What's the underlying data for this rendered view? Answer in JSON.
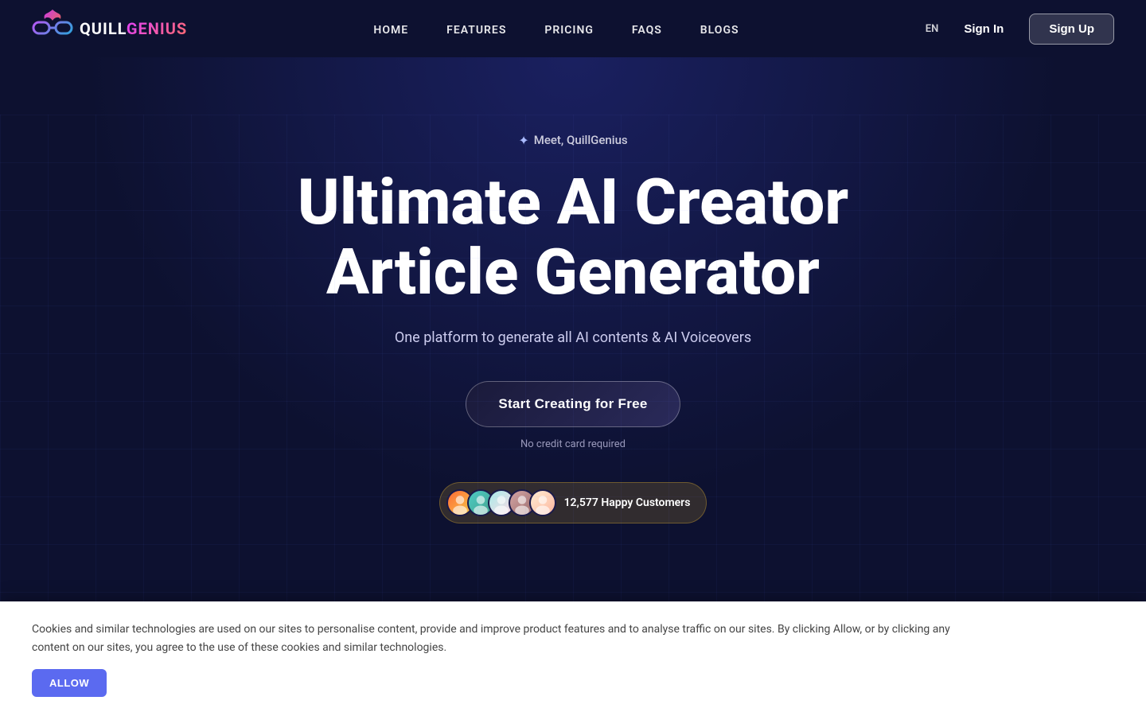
{
  "brand": {
    "quill": "QUILL",
    "genius": "GENIUS"
  },
  "nav": {
    "links": [
      {
        "id": "home",
        "label": "HOME"
      },
      {
        "id": "features",
        "label": "FEATURES"
      },
      {
        "id": "pricing",
        "label": "PRICING"
      },
      {
        "id": "faqs",
        "label": "FAQS"
      },
      {
        "id": "blogs",
        "label": "BLOGS"
      }
    ],
    "lang": "EN",
    "sign_in_label": "Sign In",
    "sign_up_label": "Sign Up"
  },
  "hero": {
    "meet_label": "Meet, QuillGenius",
    "title_line1": "Ultimate AI Creator",
    "title_line2": "Article Generator",
    "subtitle": "One platform to generate all AI contents & AI Voiceovers",
    "cta_label": "Start Creating for Free",
    "no_cc_text": "No credit card required",
    "customers_count": "12,577 Happy Customers",
    "avatars": [
      {
        "id": 1,
        "initials": ""
      },
      {
        "id": 2,
        "initials": ""
      },
      {
        "id": 3,
        "initials": ""
      },
      {
        "id": 4,
        "initials": ""
      },
      {
        "id": 5,
        "initials": ""
      }
    ]
  },
  "cookie": {
    "text": "Cookies and similar technologies are used on our sites to personalise content, provide and improve product features and to analyse traffic on our sites. By clicking Allow, or by clicking any content on our sites, you agree to the use of these cookies and similar technologies.",
    "allow_label": "ALLOW"
  },
  "icons": {
    "sparkle": "✦",
    "quill_logo": "✦"
  }
}
